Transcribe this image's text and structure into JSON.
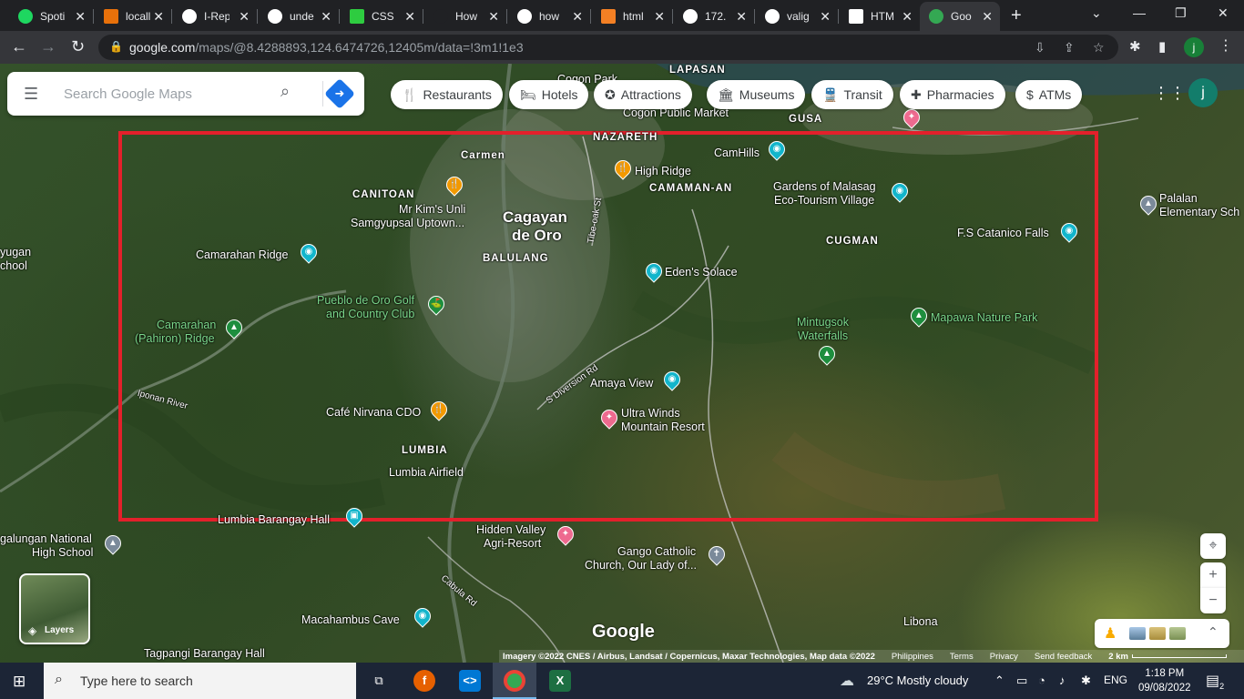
{
  "browser": {
    "tabs": [
      {
        "label": "Spoti",
        "favicon_color": "#1ed760"
      },
      {
        "label": "locall",
        "favicon_color": "#e8710a"
      },
      {
        "label": "I-Rep",
        "favicon_color": "#ffffff"
      },
      {
        "label": "unde",
        "favicon_color": "#ffffff"
      },
      {
        "label": "CSS t",
        "favicon_color": "#2ecc40"
      },
      {
        "label": "How",
        "favicon_color": "#202124"
      },
      {
        "label": "how",
        "favicon_color": "#ffffff"
      },
      {
        "label": "html",
        "favicon_color": "#f48024"
      },
      {
        "label": "172.",
        "favicon_color": "#ffffff"
      },
      {
        "label": "valig",
        "favicon_color": "#ffffff"
      },
      {
        "label": "HTM",
        "favicon_color": "#ffffff"
      },
      {
        "label": "Goo",
        "favicon_color": "#34a853"
      }
    ],
    "tab_close": "✕",
    "new_tab": "+",
    "url_host": "google.com",
    "url_path": "/maps/@8.4288893,124.6474726,12405m/data=!3m1!1e3",
    "profile_initial": "j"
  },
  "search": {
    "placeholder": "Search Google Maps"
  },
  "chips": [
    {
      "label": "Restaurants",
      "icon": "🍴"
    },
    {
      "label": "Hotels",
      "icon": "🛏"
    },
    {
      "label": "Attractions",
      "icon": "✪"
    },
    {
      "label": "Museums",
      "icon": "🏛"
    },
    {
      "label": "Transit",
      "icon": "🚆"
    },
    {
      "label": "Pharmacies",
      "icon": "✚"
    },
    {
      "label": "ATMs",
      "icon": "$"
    }
  ],
  "account_initial": "j",
  "map": {
    "places": [
      {
        "text": "Carmen"
      },
      {
        "text": "CANITOAN"
      },
      {
        "text": "Mr Kim's Unli"
      },
      {
        "text": "Samgyupsal Uptown..."
      },
      {
        "text": "Cagayan"
      },
      {
        "text": "de Oro"
      },
      {
        "text": "BALULANG"
      },
      {
        "text": "NAZARETH"
      },
      {
        "text": "High Ridge"
      },
      {
        "text": "CAMAMAN-AN"
      },
      {
        "text": "CamHills"
      },
      {
        "text": "Gardens of Malasag"
      },
      {
        "text": "Eco-Tourism Village"
      },
      {
        "text": "CUGMAN"
      },
      {
        "text": "F.S Catanico Falls"
      },
      {
        "text": "Palalan"
      },
      {
        "text": "Elementary Sch"
      },
      {
        "text": "Camarahan Ridge"
      },
      {
        "text": "Pueblo de Oro Golf"
      },
      {
        "text": "and Country Club"
      },
      {
        "text": "Eden's Solace"
      },
      {
        "text": "Mintugsok"
      },
      {
        "text": "Waterfalls"
      },
      {
        "text": "Mapawa Nature Park"
      },
      {
        "text": "Camarahan"
      },
      {
        "text": "(Pahiron) Ridge"
      },
      {
        "text": "Amaya View"
      },
      {
        "text": "Ultra Winds"
      },
      {
        "text": "Mountain Resort"
      },
      {
        "text": "Café Nirvana CDO"
      },
      {
        "text": "LUMBIA"
      },
      {
        "text": "Lumbia Airfield"
      },
      {
        "text": "Lumbia Barangay Hall"
      },
      {
        "text": "Hidden Valley"
      },
      {
        "text": "Agri-Resort"
      },
      {
        "text": "Gango Catholic"
      },
      {
        "text": "Church, Our Lady of..."
      },
      {
        "text": "Macahambus Cave"
      },
      {
        "text": "Libona"
      },
      {
        "text": "Tagpangi Barangay Hall"
      },
      {
        "text": "galungan National"
      },
      {
        "text": "High School"
      },
      {
        "text": "yugan"
      },
      {
        "text": "chool"
      },
      {
        "text": "LAPASAN"
      },
      {
        "text": "Cogon Public Market"
      },
      {
        "text": "GUSA"
      },
      {
        "text": "Cogon Park"
      },
      {
        "text": "Iponan River"
      },
      {
        "text": "S Diversion Rd"
      },
      {
        "text": "Cabula Rd"
      },
      {
        "text": "Tibe-oak St"
      }
    ],
    "layers_label": "Layers",
    "google_logo": "Google",
    "footer": {
      "imagery": "Imagery ©2022 CNES / Airbus, Landsat / Copernicus, Maxar Technologies, Map data ©2022",
      "country": "Philippines",
      "terms": "Terms",
      "privacy": "Privacy",
      "feedback": "Send feedback",
      "scale": "2 km"
    },
    "highlight_color": "#e3202b"
  },
  "taskbar": {
    "search_text": "Type here to search",
    "weather": "29°C  Mostly cloudy",
    "lang": "ENG",
    "time": "1:18 PM",
    "date": "09/08/2022",
    "notifications": "2"
  }
}
